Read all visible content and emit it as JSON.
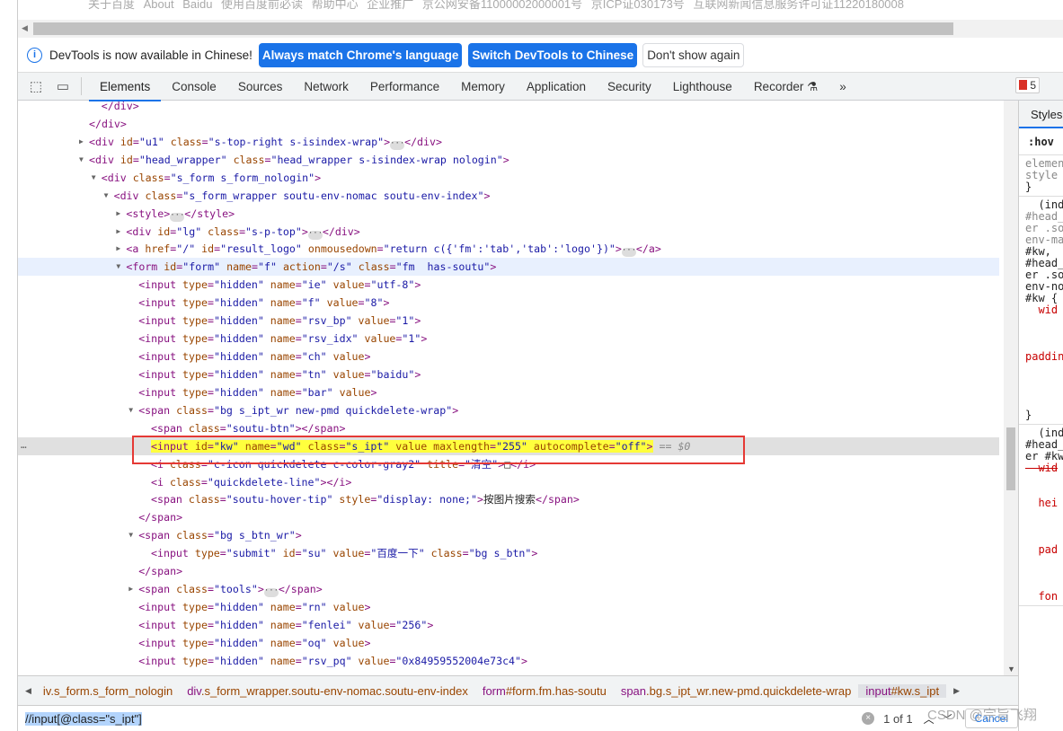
{
  "page_footer_text": "关于百度   About Baidu   使用百度前必读   帮助中心   企业推广   京公网安备11000002000001号   京ICP证030173号   互联网新闻信息服务许可证11220180008",
  "infobar": {
    "message": "DevTools is now available in Chinese!",
    "btn_match": "Always match Chrome's language",
    "btn_switch": "Switch DevTools to Chinese",
    "btn_dismiss": "Don't show again"
  },
  "tabs": [
    {
      "label": "Elements",
      "active": true
    },
    {
      "label": "Console"
    },
    {
      "label": "Sources"
    },
    {
      "label": "Network"
    },
    {
      "label": "Performance"
    },
    {
      "label": "Memory"
    },
    {
      "label": "Application"
    },
    {
      "label": "Security"
    },
    {
      "label": "Lighthouse"
    },
    {
      "label": "Recorder ⚗"
    }
  ],
  "more_tabs": "»",
  "error_count": "5",
  "dom_lines": [
    {
      "i": 6,
      "code": "</div>"
    },
    {
      "i": 5,
      "code": "</div>"
    },
    {
      "i": 5,
      "tri": "closed",
      "code": "<div id=\"u1\" class=\"s-top-right s-isindex-wrap\">",
      "ell": true,
      "post": "</div>"
    },
    {
      "i": 5,
      "tri": "open",
      "code": "<div id=\"head_wrapper\" class=\"head_wrapper s-isindex-wrap nologin\">"
    },
    {
      "i": 6,
      "tri": "open",
      "code": "<div class=\"s_form s_form_nologin\">"
    },
    {
      "i": 7,
      "tri": "open",
      "code": "<div class=\"s_form_wrapper soutu-env-nomac soutu-env-index\">"
    },
    {
      "i": 8,
      "tri": "closed",
      "code": "<style>",
      "ell": true,
      "post": "</style>"
    },
    {
      "i": 8,
      "tri": "closed",
      "code": "<div id=\"lg\" class=\"s-p-top\">",
      "ell": true,
      "post": "</div>"
    },
    {
      "i": 8,
      "tri": "closed",
      "code": "<a href=\"/\" id=\"result_logo\" onmousedown=\"return c({'fm':'tab','tab':'logo'})\">",
      "ell": true,
      "post": "</a>"
    },
    {
      "i": 8,
      "tri": "open",
      "code": "<form id=\"form\" name=\"f\" action=\"/s\" class=\"fm  has-soutu\">",
      "state": "hover"
    },
    {
      "i": 9,
      "code": "<input type=\"hidden\" name=\"ie\" value=\"utf-8\">"
    },
    {
      "i": 9,
      "code": "<input type=\"hidden\" name=\"f\" value=\"8\">"
    },
    {
      "i": 9,
      "code": "<input type=\"hidden\" name=\"rsv_bp\" value=\"1\">"
    },
    {
      "i": 9,
      "code": "<input type=\"hidden\" name=\"rsv_idx\" value=\"1\">"
    },
    {
      "i": 9,
      "code": "<input type=\"hidden\" name=\"ch\" value>"
    },
    {
      "i": 9,
      "code": "<input type=\"hidden\" name=\"tn\" value=\"baidu\">"
    },
    {
      "i": 9,
      "code": "<input type=\"hidden\" name=\"bar\" value>"
    },
    {
      "i": 9,
      "tri": "open",
      "code": "<span class=\"bg s_ipt_wr new-pmd quickdelete-wrap\">"
    },
    {
      "i": 10,
      "code": "<span class=\"soutu-btn\"></span>"
    },
    {
      "i": 10,
      "code": "<input id=\"kw\" name=\"wd\" class=\"s_ipt\" value maxlength=\"255\" autocomplete=\"off\">",
      "state": "selected",
      "eq": " == $0"
    },
    {
      "i": 10,
      "code": "<i class=\"c-icon quickdelete c-color-gray2\" title=\"清空\">□</i>"
    },
    {
      "i": 10,
      "code": "<i class=\"quickdelete-line\"></i>"
    },
    {
      "i": 10,
      "code": "<span class=\"soutu-hover-tip\" style=\"display: none;\">按图片搜索</span>"
    },
    {
      "i": 9,
      "code": "</span>"
    },
    {
      "i": 9,
      "tri": "open",
      "code": "<span class=\"bg s_btn_wr\">"
    },
    {
      "i": 10,
      "code": "<input type=\"submit\" id=\"su\" value=\"百度一下\" class=\"bg s_btn\">"
    },
    {
      "i": 9,
      "code": "</span>"
    },
    {
      "i": 9,
      "tri": "closed",
      "code": "<span class=\"tools\">",
      "ell": true,
      "post": "</span>"
    },
    {
      "i": 9,
      "code": "<input type=\"hidden\" name=\"rn\" value>"
    },
    {
      "i": 9,
      "code": "<input type=\"hidden\" name=\"fenlei\" value=\"256\">"
    },
    {
      "i": 9,
      "code": "<input type=\"hidden\" name=\"oq\" value>"
    },
    {
      "i": 9,
      "code": "<input type=\"hidden\" name=\"rsv_pq\" value=\"0x84959552004e73c4\">"
    }
  ],
  "styles_pane": {
    "tab": "Styles",
    "hov": ":hov",
    "blocks": [
      [
        {
          "t": "elemen",
          "c": "g"
        },
        {
          "t": "style",
          "c": "g"
        },
        {
          "t": "}",
          "c": ""
        }
      ],
      [
        {
          "t": "  (ind",
          "c": ""
        },
        {
          "t": "#head_",
          "c": "g"
        },
        {
          "t": "er .so",
          "c": "g"
        },
        {
          "t": "env-ma",
          "c": "g"
        },
        {
          "t": "#kw,",
          "c": ""
        },
        {
          "t": "#head_",
          "c": ""
        },
        {
          "t": "er .so",
          "c": ""
        },
        {
          "t": "env-no",
          "c": ""
        },
        {
          "t": "#kw {",
          "c": ""
        },
        {
          "t": "  wid",
          "c": "p"
        },
        {
          "t": "",
          "c": ""
        },
        {
          "t": "",
          "c": ""
        },
        {
          "t": "",
          "c": ""
        },
        {
          "t": "paddin",
          "c": "p"
        },
        {
          "t": "",
          "c": ""
        },
        {
          "t": "",
          "c": ""
        },
        {
          "t": "",
          "c": ""
        },
        {
          "t": "",
          "c": ""
        },
        {
          "t": "}",
          "c": ""
        }
      ],
      [
        {
          "t": "  (ind",
          "c": ""
        },
        {
          "t": "#head_",
          "c": ""
        },
        {
          "t": "er #kw",
          "c": ""
        },
        {
          "t": "  wid",
          "c": "s"
        },
        {
          "t": "",
          "c": ""
        },
        {
          "t": "",
          "c": ""
        },
        {
          "t": "  hei",
          "c": "p"
        },
        {
          "t": "",
          "c": ""
        },
        {
          "t": "",
          "c": ""
        },
        {
          "t": "",
          "c": ""
        },
        {
          "t": "  pad",
          "c": "p"
        },
        {
          "t": "",
          "c": ""
        },
        {
          "t": "",
          "c": ""
        },
        {
          "t": "",
          "c": ""
        },
        {
          "t": "  fon",
          "c": "p"
        }
      ]
    ]
  },
  "breadcrumbs": [
    {
      "tag": "",
      "rest": "iv.s_form.s_form_nologin"
    },
    {
      "tag": "div",
      "rest": ".s_form_wrapper.soutu-env-nomac.soutu-env-index"
    },
    {
      "tag": "form",
      "rest": "#form.fm.has-soutu"
    },
    {
      "tag": "span",
      "rest": ".bg.s_ipt_wr.new-pmd.quickdelete-wrap"
    },
    {
      "tag": "input",
      "rest": "#kw.s_ipt"
    }
  ],
  "search": {
    "query": "//input[@class=\"s_ipt\"]",
    "count": "1 of 1",
    "cancel": "Cancel"
  },
  "watermark": "CSDN @宗旨飞翔",
  "colors": {
    "accent": "#1a73e8",
    "tag": "#881280",
    "attr_name": "#994500",
    "attr_value": "#1a1aa6",
    "highlight": "#ffff3d",
    "annotation_box": "#e53935"
  }
}
